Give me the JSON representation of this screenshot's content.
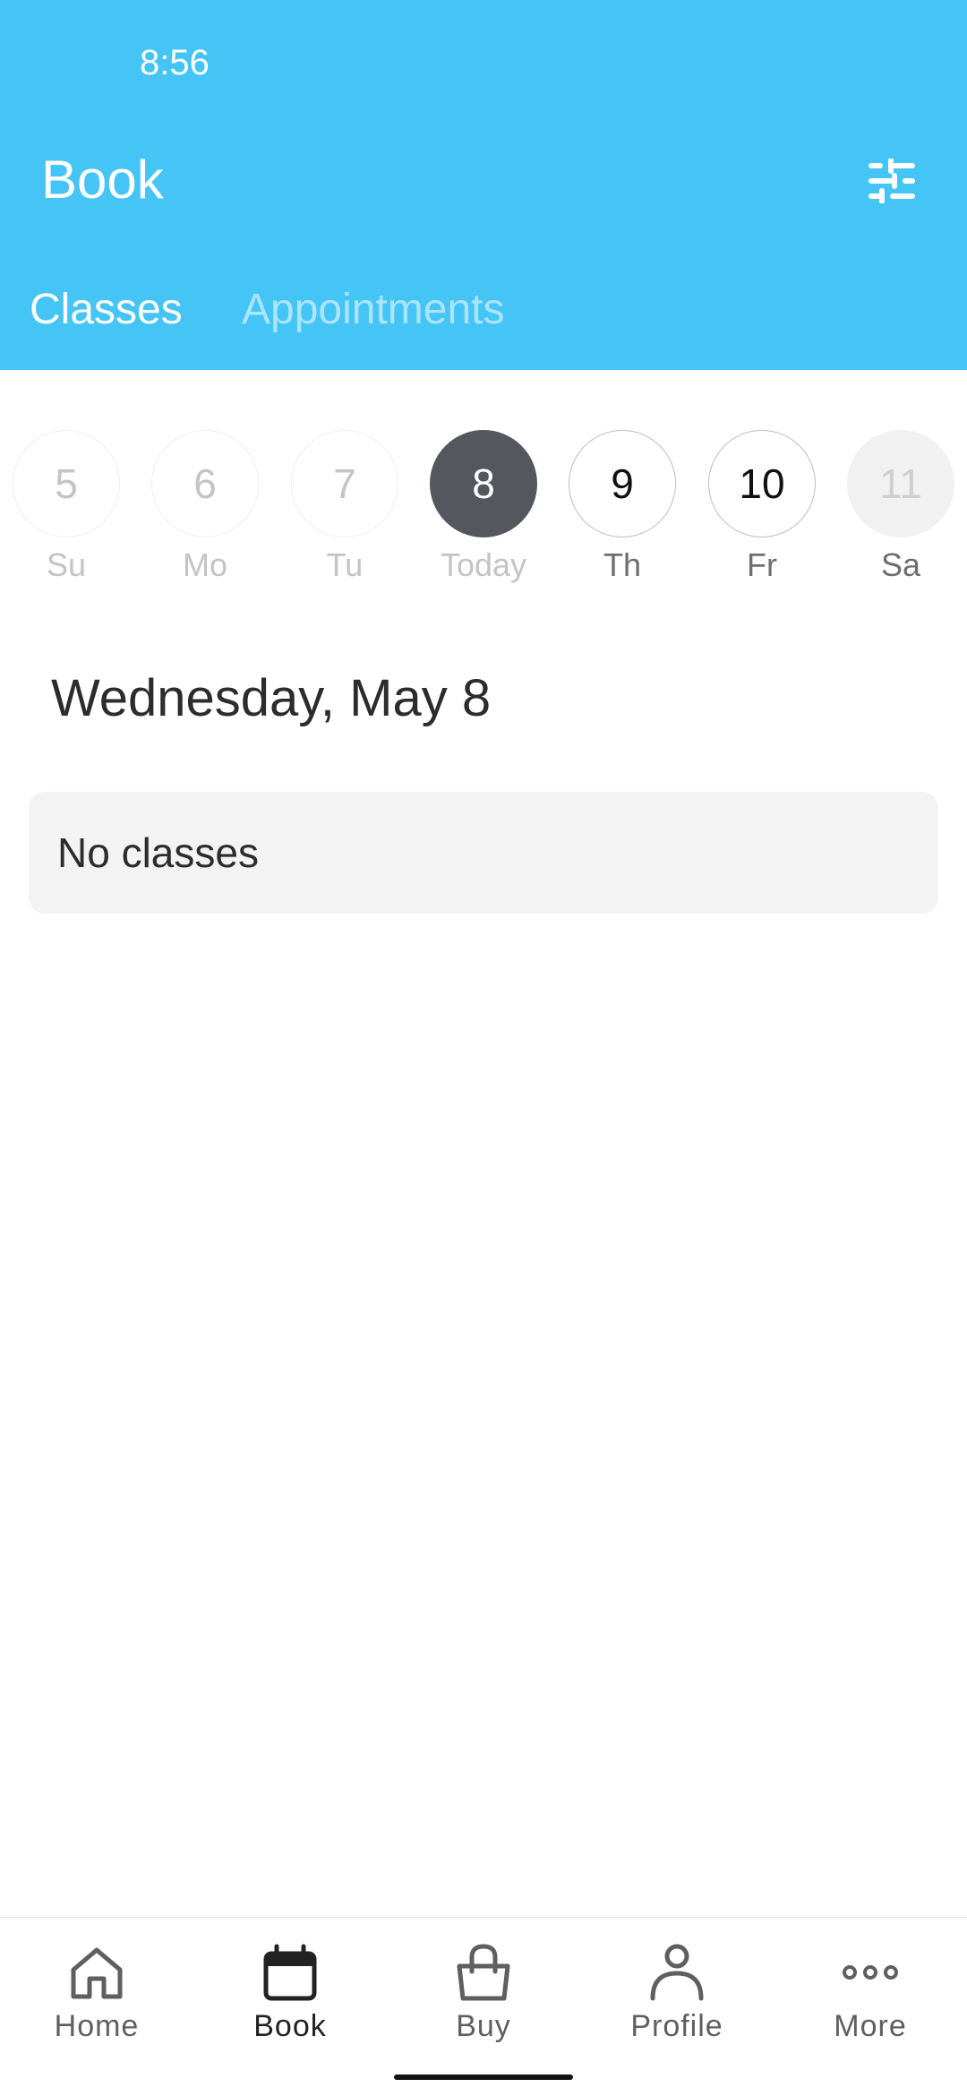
{
  "status_bar": {
    "time": "8:56"
  },
  "header": {
    "title": "Book",
    "filter_icon": "sliders-icon",
    "background_color": "#45c5f5"
  },
  "tabs": [
    {
      "label": "Classes",
      "active": true
    },
    {
      "label": "Appointments",
      "active": false
    }
  ],
  "days": [
    {
      "number": "5",
      "label": "Su",
      "state": "past"
    },
    {
      "number": "6",
      "label": "Mo",
      "state": "past"
    },
    {
      "number": "7",
      "label": "Tu",
      "state": "past"
    },
    {
      "number": "8",
      "label": "Today",
      "state": "selected"
    },
    {
      "number": "9",
      "label": "Th",
      "state": "available"
    },
    {
      "number": "10",
      "label": "Fr",
      "state": "available"
    },
    {
      "number": "11",
      "label": "Sa",
      "state": "disabled"
    }
  ],
  "selected_date": "Wednesday, May 8",
  "empty_state": "No classes",
  "bottom_nav": [
    {
      "label": "Home",
      "icon": "home-icon",
      "active": false
    },
    {
      "label": "Book",
      "icon": "calendar-icon",
      "active": true
    },
    {
      "label": "Buy",
      "icon": "shopping-bag-icon",
      "active": false
    },
    {
      "label": "Profile",
      "icon": "person-icon",
      "active": false
    },
    {
      "label": "More",
      "icon": "more-dots-icon",
      "active": false
    }
  ]
}
